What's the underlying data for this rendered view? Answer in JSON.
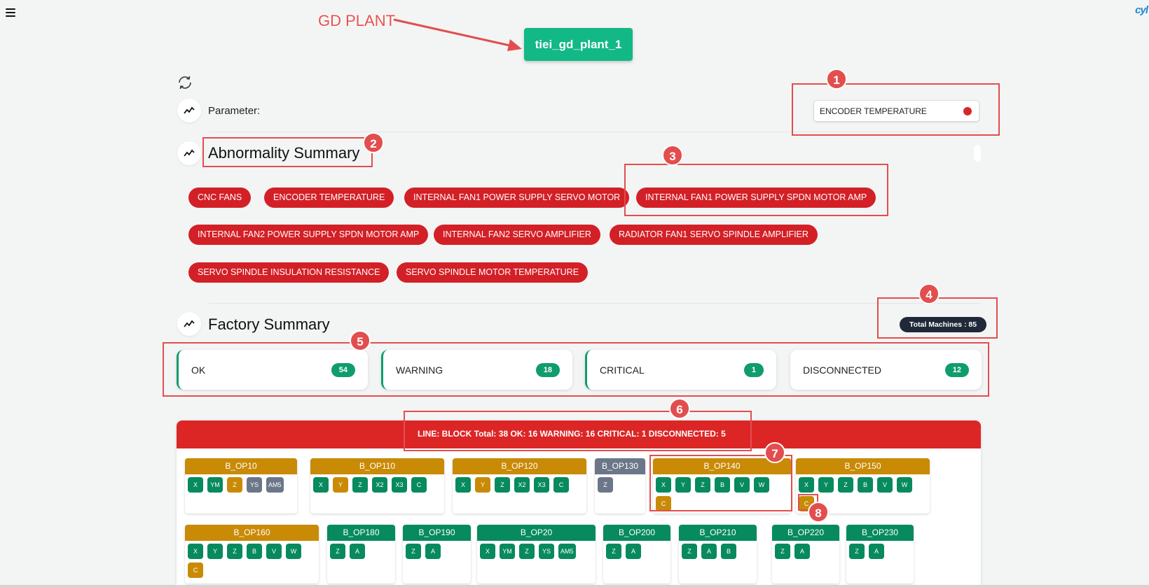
{
  "header": {
    "brand": "cyl",
    "annotation_label": "GD PLANT",
    "plant_button": "tiei_gd_plant_1"
  },
  "parameter": {
    "label": "Parameter:",
    "selected": "ENCODER TEMPERATURE",
    "status_color": "#d62828"
  },
  "abnormality": {
    "title": "Abnormality Summary",
    "tags": [
      "CNC FANS",
      "ENCODER TEMPERATURE",
      "INTERNAL FAN1 POWER SUPPLY SERVO MOTOR",
      "INTERNAL FAN1 POWER SUPPLY SPDN MOTOR AMP",
      "INTERNAL FAN2 POWER SUPPLY SPDN MOTOR AMP",
      "INTERNAL FAN2 SERVO AMPLIFIER",
      "RADIATOR FAN1 SERVO SPINDLE AMPLIFIER",
      "SERVO SPINDLE INSULATION RESISTANCE",
      "SERVO SPINDLE MOTOR TEMPERATURE"
    ]
  },
  "factory": {
    "title": "Factory Summary",
    "total_machines": "Total Machines : 85",
    "stats": [
      {
        "label": "OK",
        "count": "54"
      },
      {
        "label": "WARNING",
        "count": "18"
      },
      {
        "label": "CRITICAL",
        "count": "1"
      },
      {
        "label": "DISCONNECTED",
        "count": "12"
      }
    ]
  },
  "line": {
    "header": "LINE: BLOCK  Total: 38    OK: 16  WARNING: 16  CRITICAL: 1  DISCONNECTED: 5",
    "operations": [
      {
        "name": "B_OP10",
        "status": "warning",
        "axes": [
          {
            "l": "X",
            "s": "ok"
          },
          {
            "l": "YM",
            "s": "ok"
          },
          {
            "l": "Z",
            "s": "warning"
          },
          {
            "l": "YS",
            "s": "disconnected"
          },
          {
            "l": "AM5",
            "s": "disconnected"
          }
        ]
      },
      {
        "name": "B_OP110",
        "status": "warning",
        "axes": [
          {
            "l": "X",
            "s": "ok"
          },
          {
            "l": "Y",
            "s": "warning"
          },
          {
            "l": "Z",
            "s": "ok"
          },
          {
            "l": "X2",
            "s": "ok"
          },
          {
            "l": "X3",
            "s": "ok"
          },
          {
            "l": "C",
            "s": "ok"
          }
        ]
      },
      {
        "name": "B_OP120",
        "status": "warning",
        "axes": [
          {
            "l": "X",
            "s": "ok"
          },
          {
            "l": "Y",
            "s": "warning"
          },
          {
            "l": "Z",
            "s": "ok"
          },
          {
            "l": "X2",
            "s": "ok"
          },
          {
            "l": "X3",
            "s": "ok"
          },
          {
            "l": "C",
            "s": "ok"
          }
        ]
      },
      {
        "name": "B_OP130",
        "status": "disconnected",
        "axes": [
          {
            "l": "Z",
            "s": "disconnected"
          }
        ]
      },
      {
        "name": "B_OP140",
        "status": "warning",
        "axes": [
          {
            "l": "X",
            "s": "ok"
          },
          {
            "l": "Y",
            "s": "ok"
          },
          {
            "l": "Z",
            "s": "ok"
          },
          {
            "l": "B",
            "s": "ok"
          },
          {
            "l": "V",
            "s": "ok"
          },
          {
            "l": "W",
            "s": "ok"
          },
          {
            "l": "C",
            "s": "warning"
          }
        ]
      },
      {
        "name": "B_OP150",
        "status": "warning",
        "axes": [
          {
            "l": "X",
            "s": "ok"
          },
          {
            "l": "Y",
            "s": "ok"
          },
          {
            "l": "Z",
            "s": "ok"
          },
          {
            "l": "B",
            "s": "ok"
          },
          {
            "l": "V",
            "s": "ok"
          },
          {
            "l": "W",
            "s": "ok"
          },
          {
            "l": "C",
            "s": "warning"
          }
        ]
      },
      {
        "name": "B_OP160",
        "status": "warning",
        "axes": [
          {
            "l": "X",
            "s": "ok"
          },
          {
            "l": "Y",
            "s": "ok"
          },
          {
            "l": "Z",
            "s": "ok"
          },
          {
            "l": "B",
            "s": "ok"
          },
          {
            "l": "V",
            "s": "ok"
          },
          {
            "l": "W",
            "s": "ok"
          },
          {
            "l": "C",
            "s": "warning"
          }
        ]
      },
      {
        "name": "B_OP180",
        "status": "ok",
        "axes": [
          {
            "l": "Z",
            "s": "ok"
          },
          {
            "l": "A",
            "s": "ok"
          }
        ]
      },
      {
        "name": "B_OP190",
        "status": "ok",
        "axes": [
          {
            "l": "Z",
            "s": "ok"
          },
          {
            "l": "A",
            "s": "ok"
          }
        ]
      },
      {
        "name": "B_OP20",
        "status": "ok",
        "axes": [
          {
            "l": "X",
            "s": "ok"
          },
          {
            "l": "YM",
            "s": "ok"
          },
          {
            "l": "Z",
            "s": "ok"
          },
          {
            "l": "YS",
            "s": "ok"
          },
          {
            "l": "AM5",
            "s": "ok"
          }
        ]
      },
      {
        "name": "B_OP200",
        "status": "ok",
        "axes": [
          {
            "l": "Z",
            "s": "ok"
          },
          {
            "l": "A",
            "s": "ok"
          }
        ]
      },
      {
        "name": "B_OP210",
        "status": "ok",
        "axes": [
          {
            "l": "Z",
            "s": "ok"
          },
          {
            "l": "A",
            "s": "ok"
          },
          {
            "l": "B",
            "s": "ok"
          }
        ]
      },
      {
        "name": "B_OP220",
        "status": "ok",
        "axes": [
          {
            "l": "Z",
            "s": "ok"
          },
          {
            "l": "A",
            "s": "ok"
          }
        ]
      },
      {
        "name": "B_OP230",
        "status": "ok",
        "axes": [
          {
            "l": "Z",
            "s": "ok"
          },
          {
            "l": "A",
            "s": "ok"
          }
        ]
      }
    ]
  },
  "annotations": [
    "1",
    "2",
    "3",
    "4",
    "5",
    "6",
    "7",
    "8"
  ],
  "colors": {
    "ok": "#078a5e",
    "warning": "#c98a06",
    "disconnected": "#6b7789",
    "critical": "#dc2626",
    "accent": "#12b886",
    "annotation": "#e24e4e"
  }
}
